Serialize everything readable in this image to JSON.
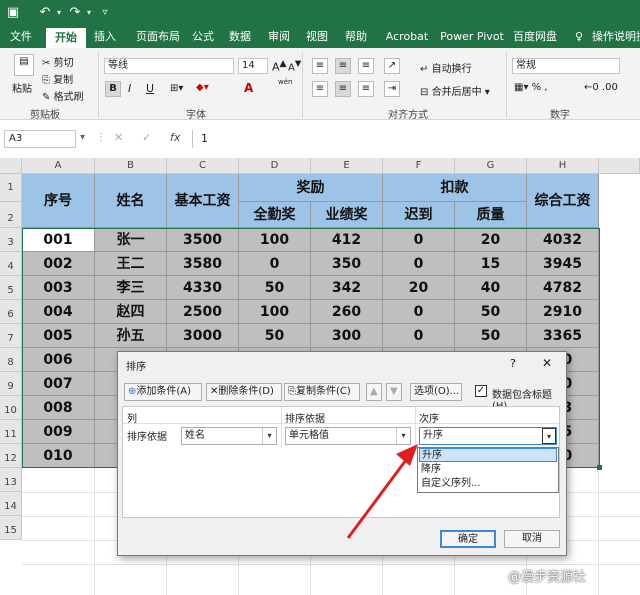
{
  "colors": {
    "excel_green": "#217346",
    "header_fill": "#9dc3e6",
    "data_fill": "#bfbfbf",
    "arrow_red": "#e02020"
  },
  "tabs": [
    "文件",
    "开始",
    "插入",
    "页面布局",
    "公式",
    "数据",
    "审阅",
    "视图",
    "帮助",
    "Acrobat",
    "Power Pivot",
    "百度网盘",
    "操作说明搜"
  ],
  "ribbon": {
    "clipboard": {
      "paste": "粘贴",
      "cut": "剪切",
      "copy": "复制",
      "format_painter": "格式刷",
      "label": "剪贴板"
    },
    "font": {
      "name": "等线",
      "size": "14",
      "bold": "B",
      "italic": "I",
      "underline": "U",
      "label": "字体",
      "font_color": "A",
      "wen": "wén"
    },
    "align": {
      "wrap": "自动换行",
      "merge": "合并后居中",
      "label": "对齐方式"
    },
    "number": {
      "format": "常规",
      "label": "数字"
    }
  },
  "formula_bar": {
    "cell_ref": "A3",
    "fx": "fx",
    "value": "1"
  },
  "columns": [
    "A",
    "B",
    "C",
    "D",
    "E",
    "F",
    "G",
    "H"
  ],
  "rows": [
    "1",
    "2",
    "3",
    "4",
    "5",
    "6",
    "7",
    "8",
    "9",
    "10",
    "11",
    "12",
    "13",
    "14",
    "15"
  ],
  "table": {
    "h_seq": "序号",
    "h_name": "姓名",
    "h_base": "基本工资",
    "h_bonus": "奖励",
    "h_deduct": "扣款",
    "h_total": "综合工资",
    "h_attend": "全勤奖",
    "h_perf": "业绩奖",
    "h_late": "迟到",
    "h_quality": "质量",
    "data": [
      [
        "001",
        "张一",
        "3500",
        "100",
        "412",
        "0",
        "20",
        "4032"
      ],
      [
        "002",
        "王二",
        "3580",
        "0",
        "350",
        "0",
        "15",
        "3945"
      ],
      [
        "003",
        "李三",
        "4330",
        "50",
        "342",
        "20",
        "40",
        "4782"
      ],
      [
        "004",
        "赵四",
        "2500",
        "100",
        "260",
        "0",
        "50",
        "2910"
      ],
      [
        "005",
        "孙五",
        "3000",
        "50",
        "300",
        "0",
        "50",
        "3365"
      ],
      [
        "006",
        "",
        "",
        "",
        "",
        "",
        "",
        "50"
      ],
      [
        "007",
        "",
        "",
        "",
        "",
        "",
        "",
        "10"
      ],
      [
        "008",
        "",
        "",
        "",
        "",
        "",
        "",
        "53"
      ],
      [
        "009",
        "",
        "",
        "",
        "",
        "",
        "",
        "45"
      ],
      [
        "010",
        "",
        "",
        "",
        "",
        "",
        "",
        "60"
      ]
    ]
  },
  "dialog": {
    "title": "排序",
    "help": "?",
    "close": "✕",
    "add": "添加条件(A)",
    "delete": "删除条件(D)",
    "copy": "复制条件(C)",
    "options": "选项(O)...",
    "has_header": "数据包含标题(H)",
    "col_header": "列",
    "basis_header": "排序依据",
    "order_header": "次序",
    "sort_by": "排序依据",
    "field": "姓名",
    "basis": "单元格值",
    "order": "升序",
    "options_list": [
      "升序",
      "降序",
      "自定义序列..."
    ],
    "ok": "确定",
    "cancel": "取消"
  },
  "watermark": "@漫步资源社"
}
